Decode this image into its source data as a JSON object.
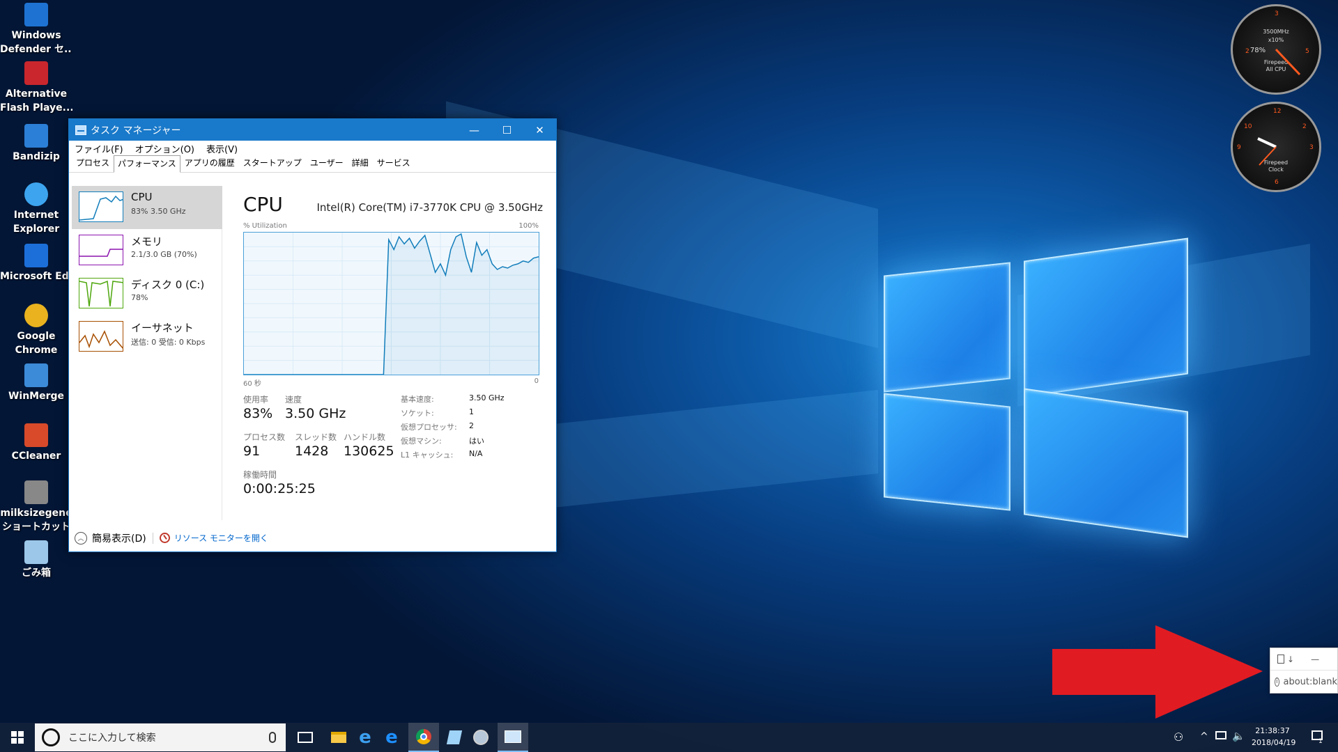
{
  "desktop_icons": [
    {
      "label": "Windows\nDefender セ...",
      "name": "windows-defender-icon"
    },
    {
      "label": "Alternative\nFlash Playe...",
      "name": "alternative-flash-player-icon"
    },
    {
      "label": "Bandizip",
      "name": "bandizip-icon"
    },
    {
      "label": "Internet\nExplorer",
      "name": "internet-explorer-icon"
    },
    {
      "label": "Microsoft Edge",
      "name": "microsoft-edge-icon"
    },
    {
      "label": "Google\nChrome",
      "name": "google-chrome-icon"
    },
    {
      "label": "WinMerge",
      "name": "winmerge-icon"
    },
    {
      "label": "CCleaner",
      "name": "ccleaner-icon"
    },
    {
      "label": "milksizegene\nショートカット",
      "name": "milksizegene-shortcut-icon"
    },
    {
      "label": "ごみ箱",
      "name": "recycle-bin-icon"
    }
  ],
  "gadgets": {
    "cpu_meter": {
      "percent": "78%",
      "freq": "3500MHz",
      "mult": "x10%",
      "label1": "Firepeed",
      "label2": "All CPU"
    },
    "clock": {
      "label1": "Firepeed",
      "label2": "Clock",
      "numbers": [
        "12",
        "3",
        "6",
        "9",
        "10",
        "2"
      ]
    }
  },
  "task_manager": {
    "title": "タスク マネージャー",
    "window_controls": {
      "minimize": "—",
      "maximize": "☐",
      "close": "✕"
    },
    "menu": [
      "ファイル(F)",
      "オプション(O)",
      "表示(V)"
    ],
    "tabs": [
      {
        "label": "プロセス",
        "active": false
      },
      {
        "label": "パフォーマンス",
        "active": true
      },
      {
        "label": "アプリの履歴",
        "active": false
      },
      {
        "label": "スタートアップ",
        "active": false
      },
      {
        "label": "ユーザー",
        "active": false
      },
      {
        "label": "詳細",
        "active": false
      },
      {
        "label": "サービス",
        "active": false
      }
    ],
    "sidebar": [
      {
        "name": "CPU",
        "sub": "83%  3.50 GHz",
        "color": "#117dbb"
      },
      {
        "name": "メモリ",
        "sub": "2.1/3.0 GB (70%)",
        "color": "#8b12ae"
      },
      {
        "name": "ディスク 0 (C:)",
        "sub": "78%",
        "color": "#4da60c"
      },
      {
        "name": "イーサネット",
        "sub": "送信: 0  受信: 0 Kbps",
        "color": "#a74f01"
      }
    ],
    "cpu": {
      "title": "CPU",
      "model": "Intel(R) Core(TM) i7-3770K CPU @ 3.50GHz",
      "y_label": "% Utilization",
      "y_max": "100%",
      "x_label": "60 秒",
      "x_min": "0",
      "graph_color": "#117dbb",
      "graph_history": [
        0,
        0,
        0,
        0,
        0,
        0,
        0,
        0,
        0,
        0,
        0,
        0,
        0,
        0,
        0,
        0,
        0,
        0,
        0,
        0,
        0,
        0,
        0,
        0,
        0,
        0,
        0,
        0,
        95,
        88,
        97,
        92,
        96,
        89,
        94,
        98,
        85,
        72,
        78,
        70,
        88,
        97,
        99,
        83,
        72,
        93,
        84,
        88,
        78,
        74,
        76,
        75,
        77,
        78,
        80,
        79,
        82,
        83
      ],
      "stats": {
        "utilization_label": "使用率",
        "utilization": "83%",
        "speed_label": "速度",
        "speed": "3.50 GHz",
        "processes_label": "プロセス数",
        "processes": "91",
        "threads_label": "スレッド数",
        "threads": "1428",
        "handles_label": "ハンドル数",
        "handles": "130625",
        "uptime_label": "稼働時間",
        "uptime": "0:00:25:25"
      },
      "specs": [
        {
          "label": "基本速度:",
          "value": "3.50 GHz"
        },
        {
          "label": "ソケット:",
          "value": "1"
        },
        {
          "label": "仮想プロセッサ:",
          "value": "2"
        },
        {
          "label": "仮想マシン:",
          "value": "はい"
        },
        {
          "label": "L1 キャッシュ:",
          "value": "N/A"
        }
      ]
    },
    "footer": {
      "fewer_details": "簡易表示(D)",
      "resource_monitor": "リソース モニターを開く"
    }
  },
  "popup": {
    "url": "about:blank"
  },
  "taskbar": {
    "search_placeholder": "ここに入力して検索",
    "time": "21:38:37",
    "date": "2018/04/19",
    "notification_count": "1"
  },
  "annotation": {
    "arrow_color": "#e11b22"
  }
}
